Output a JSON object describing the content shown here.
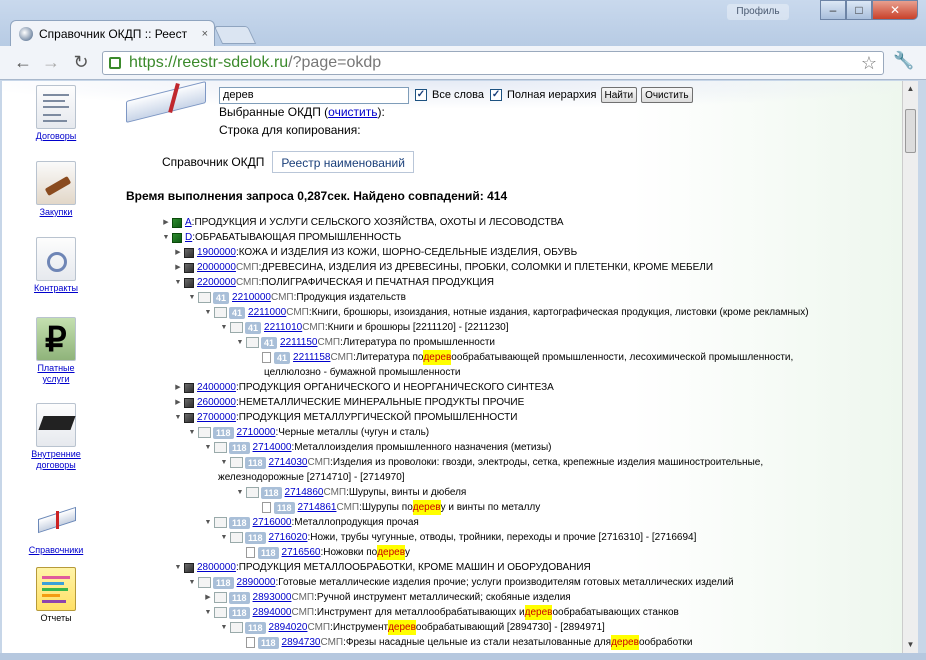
{
  "browser": {
    "tab_title": "Справочник ОКДП :: Реест",
    "tab_close": "×",
    "profile_label": "Профиль",
    "url_secure": "https://reestr-sdelok.ru",
    "url_rest": "/?page=okdp",
    "window_min": "–",
    "window_max": "□",
    "window_close": "✕"
  },
  "sidebar": [
    {
      "label": "Договоры",
      "link": true
    },
    {
      "label": "Закупки",
      "link": true
    },
    {
      "label": "Контракты",
      "link": true
    },
    {
      "label": "Платные услуги",
      "link": true
    },
    {
      "label": "Внутренние договоры",
      "link": true
    },
    {
      "label": "Справочники",
      "link": true
    },
    {
      "label": "Отчеты",
      "link": false
    }
  ],
  "search": {
    "query": "дерев",
    "all_words_label": "Все слова",
    "all_words_checked": true,
    "full_hierarchy_label": "Полная иерархия",
    "full_hierarchy_checked": true,
    "find_label": "Найти",
    "clear_label": "Очистить"
  },
  "selected": {
    "prefix": "Выбранные ОКДП (",
    "clear_link": "очистить",
    "suffix": "):"
  },
  "copy_line": "Строка для копирования:",
  "tabs": {
    "okdp": "Справочник ОКДП",
    "reestr": "Реестр наименований"
  },
  "result_line": "Время выполнения запроса 0,287сек. Найдено совпадений: 414",
  "tree": [
    {
      "level": 0,
      "icon": "green",
      "code": "A",
      "sep": ": ",
      "text": "ПРОДУКЦИЯ И УСЛУГИ СЕЛЬСКОГО ХОЗЯЙСТВА, ОХОТЫ И ЛЕСОВОДСТВА"
    },
    {
      "level": 0,
      "icon": "green",
      "open": true,
      "code": "D",
      "sep": ": ",
      "text": "ОБРАБАТЫВАЮЩАЯ ПРОМЫШЛЕННОСТЬ"
    },
    {
      "level": 1,
      "icon": "dark",
      "code": "1900000",
      "sep": ": ",
      "text": "КОЖА И ИЗДЕЛИЯ ИЗ КОЖИ, ШОРНО-СЕДЕЛЬНЫЕ ИЗДЕЛИЯ, ОБУВЬ"
    },
    {
      "level": 1,
      "icon": "dark",
      "code": "2000000",
      "smp": "СМП",
      "sep": " : ",
      "text": "ДРЕВЕСИНА, ИЗДЕЛИЯ ИЗ ДРЕВЕСИНЫ, ПРОБКИ, СОЛОМКИ И ПЛЕТЕНКИ, КРОМЕ МЕБЕЛИ"
    },
    {
      "level": 1,
      "icon": "dark",
      "open": true,
      "code": "2200000",
      "smp": "СМП",
      "sep": " : ",
      "text": "ПОЛИГРАФИЧЕСКАЯ И ПЕЧАТНАЯ ПРОДУКЦИЯ"
    },
    {
      "level": 2,
      "icon": "pages",
      "num": "41",
      "open": true,
      "code": "2210000",
      "smp": "СМП",
      "sep": " : ",
      "text": "Продукция издательств"
    },
    {
      "level": 3,
      "icon": "pages",
      "num": "41",
      "open": true,
      "code": "2211000",
      "smp": "СМП",
      "sep": " : ",
      "text": "Книги, брошюры, изоиздания, нотные издания, картографическая продукция, листовки (кроме рекламных)"
    },
    {
      "level": 4,
      "icon": "pages",
      "num": "41",
      "open": true,
      "code": "2211010",
      "smp": "СМП",
      "sep": " : ",
      "text": "Книги и брошюры [2211120] - [2211230]"
    },
    {
      "level": 5,
      "icon": "pages",
      "num": "41",
      "open": true,
      "code": "2211150",
      "smp": "СМП",
      "sep": " : ",
      "text": "Литература по промышленности"
    },
    {
      "level": 6,
      "icon": "doc",
      "num": "41",
      "code": "2211158",
      "smp": "СМП",
      "sep": " : ",
      "text": "Литература по ",
      "hl": "дерев",
      "text2": "ообрабатывающей промышленности, лесохимической промышленности,",
      "wrap": "целлюлозно - бумажной промышленности"
    },
    {
      "level": 1,
      "icon": "dark",
      "code": "2400000",
      "sep": ": ",
      "text": "ПРОДУКЦИЯ ОРГАНИЧЕСКОГО И НЕОРГАНИЧЕСКОГО СИНТЕЗА"
    },
    {
      "level": 1,
      "icon": "dark",
      "code": "2600000",
      "sep": ": ",
      "text": "НЕМЕТАЛЛИЧЕСКИЕ МИНЕРАЛЬНЫЕ ПРОДУКТЫ ПРОЧИЕ"
    },
    {
      "level": 1,
      "icon": "dark",
      "open": true,
      "code": "2700000",
      "sep": ": ",
      "text": "ПРОДУКЦИЯ МЕТАЛЛУРГИЧЕСКОЙ ПРОМЫШЛЕННОСТИ"
    },
    {
      "level": 2,
      "icon": "pages",
      "num": "118",
      "open": true,
      "code": "2710000",
      "sep": ": ",
      "text": "Черные металлы (чугун и сталь)"
    },
    {
      "level": 3,
      "icon": "pages",
      "num": "118",
      "open": true,
      "code": "2714000",
      "sep": ": ",
      "text": "Металлоизделия промышленного назначения (метизы)"
    },
    {
      "level": 4,
      "icon": "pages",
      "num": "118",
      "open": true,
      "code": "2714030",
      "smp": "СМП",
      "sep": " : ",
      "text": "Изделия из проволоки: гвозди, электроды, сетка, крепежные изделия машиностроительные,",
      "wrap": "железнодорожные [2714710] - [2714970]"
    },
    {
      "level": 5,
      "icon": "pages",
      "num": "118",
      "open": true,
      "code": "2714860",
      "smp": "СМП",
      "sep": " : ",
      "text": "Шурупы, винты и дюбеля"
    },
    {
      "level": 6,
      "icon": "doc",
      "num": "118",
      "code": "2714861",
      "smp": "СМП",
      "sep": " : ",
      "text": "Шурупы по ",
      "hl": "дерев",
      "text2": "у и винты по металлу"
    },
    {
      "level": 3,
      "icon": "pages",
      "num": "118",
      "open": true,
      "code": "2716000",
      "sep": ": ",
      "text": "Металлопродукция прочая"
    },
    {
      "level": 4,
      "icon": "pages",
      "num": "118",
      "open": true,
      "code": "2716020",
      "sep": ": ",
      "text": "Ножи, трубы чугунные, отводы, тройники, переходы и прочие [2716310] - [2716694]"
    },
    {
      "level": 5,
      "icon": "doc",
      "num": "118",
      "code": "2716560",
      "sep": ": ",
      "text": "Ножовки по ",
      "hl": "дерев",
      "text2": "у"
    },
    {
      "level": 1,
      "icon": "dark",
      "open": true,
      "code": "2800000",
      "sep": ": ",
      "text": "ПРОДУКЦИЯ МЕТАЛЛООБРАБОТКИ, КРОМЕ МАШИН И ОБОРУДОВАНИЯ"
    },
    {
      "level": 2,
      "icon": "pages",
      "num": "118",
      "open": true,
      "code": "2890000",
      "sep": ": ",
      "text": "Готовые металлические изделия прочие; услуги производителям готовых металлических изделий"
    },
    {
      "level": 3,
      "icon": "pages",
      "num": "118",
      "code": "2893000",
      "smp": "СМП",
      "sep": " : ",
      "text": "Ручной инструмент металлический; скобяные изделия"
    },
    {
      "level": 3,
      "icon": "pages",
      "num": "118",
      "open": true,
      "code": "2894000",
      "smp": "СМП",
      "sep": " : ",
      "text": "Инструмент для металлообрабатывающих и ",
      "hl": "дерев",
      "text2": "ообрабатывающих станков"
    },
    {
      "level": 4,
      "icon": "pages",
      "num": "118",
      "open": true,
      "code": "2894020",
      "smp": "СМП",
      "sep": " : ",
      "text": "Инструмент ",
      "hl": "дерев",
      "text2": "ообрабатывающий [2894730] - [2894971]"
    },
    {
      "level": 5,
      "icon": "doc",
      "num": "118",
      "code": "2894730",
      "smp": "СМП",
      "sep": " : ",
      "text": "Фрезы насадные цельные из стали незатылованные для ",
      "hl": "дерев",
      "text2": "ообработки"
    }
  ]
}
